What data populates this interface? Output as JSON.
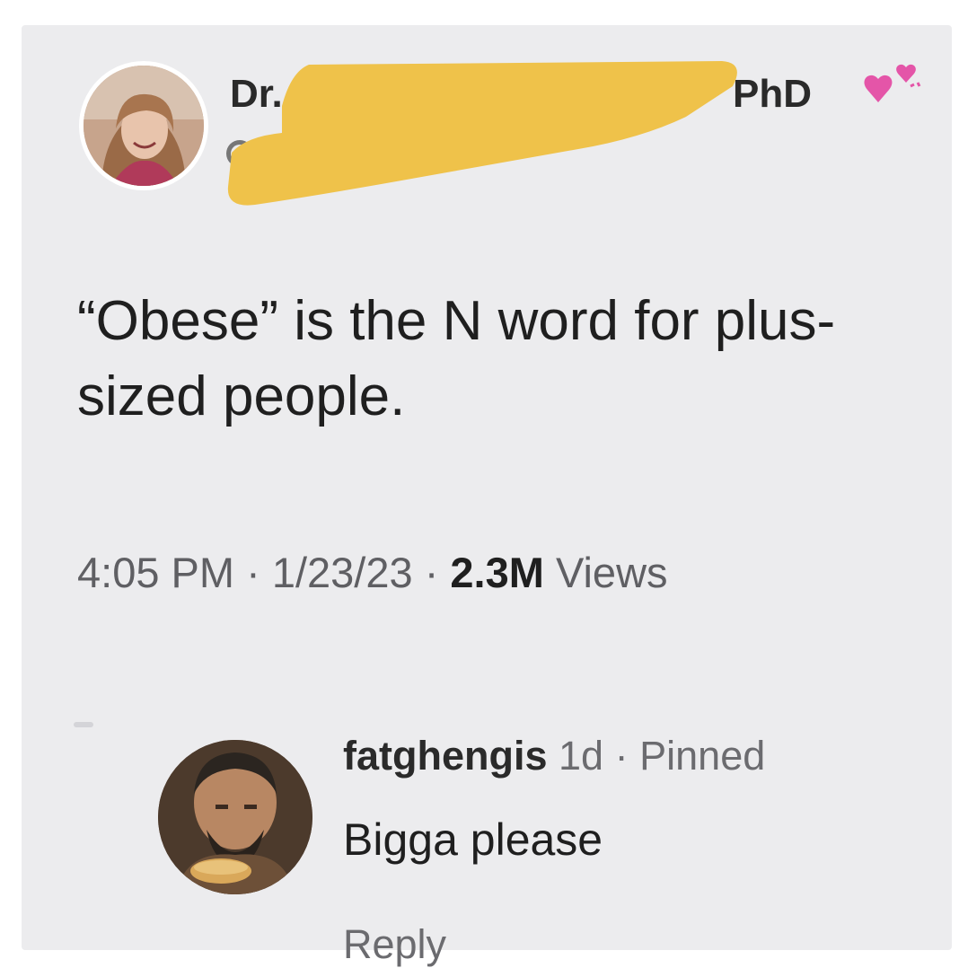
{
  "tweet": {
    "display_name_prefix": "Dr.",
    "display_name_suffix": "PhD",
    "display_name_emoji_icon": "two-hearts-icon",
    "avatar_icon": "user-avatar-photo",
    "redaction_color": "#efc24a",
    "text": "“Obese” is the N word for plus-sized people.",
    "time": "4:05 PM",
    "date": "1/23/23",
    "separator": "·",
    "views_count": "2.3M",
    "views_label": "Views"
  },
  "reply": {
    "avatar_icon": "user-avatar-photo",
    "username": "fatghengis",
    "age": "1d",
    "separator": "·",
    "pinned_label": "Pinned",
    "text": "Bigga please",
    "reply_label": "Reply"
  },
  "colors": {
    "background": "#ececee",
    "text_primary": "#1f1f1f",
    "text_secondary": "#5f5f63",
    "heart_pink": "#e455a8"
  }
}
